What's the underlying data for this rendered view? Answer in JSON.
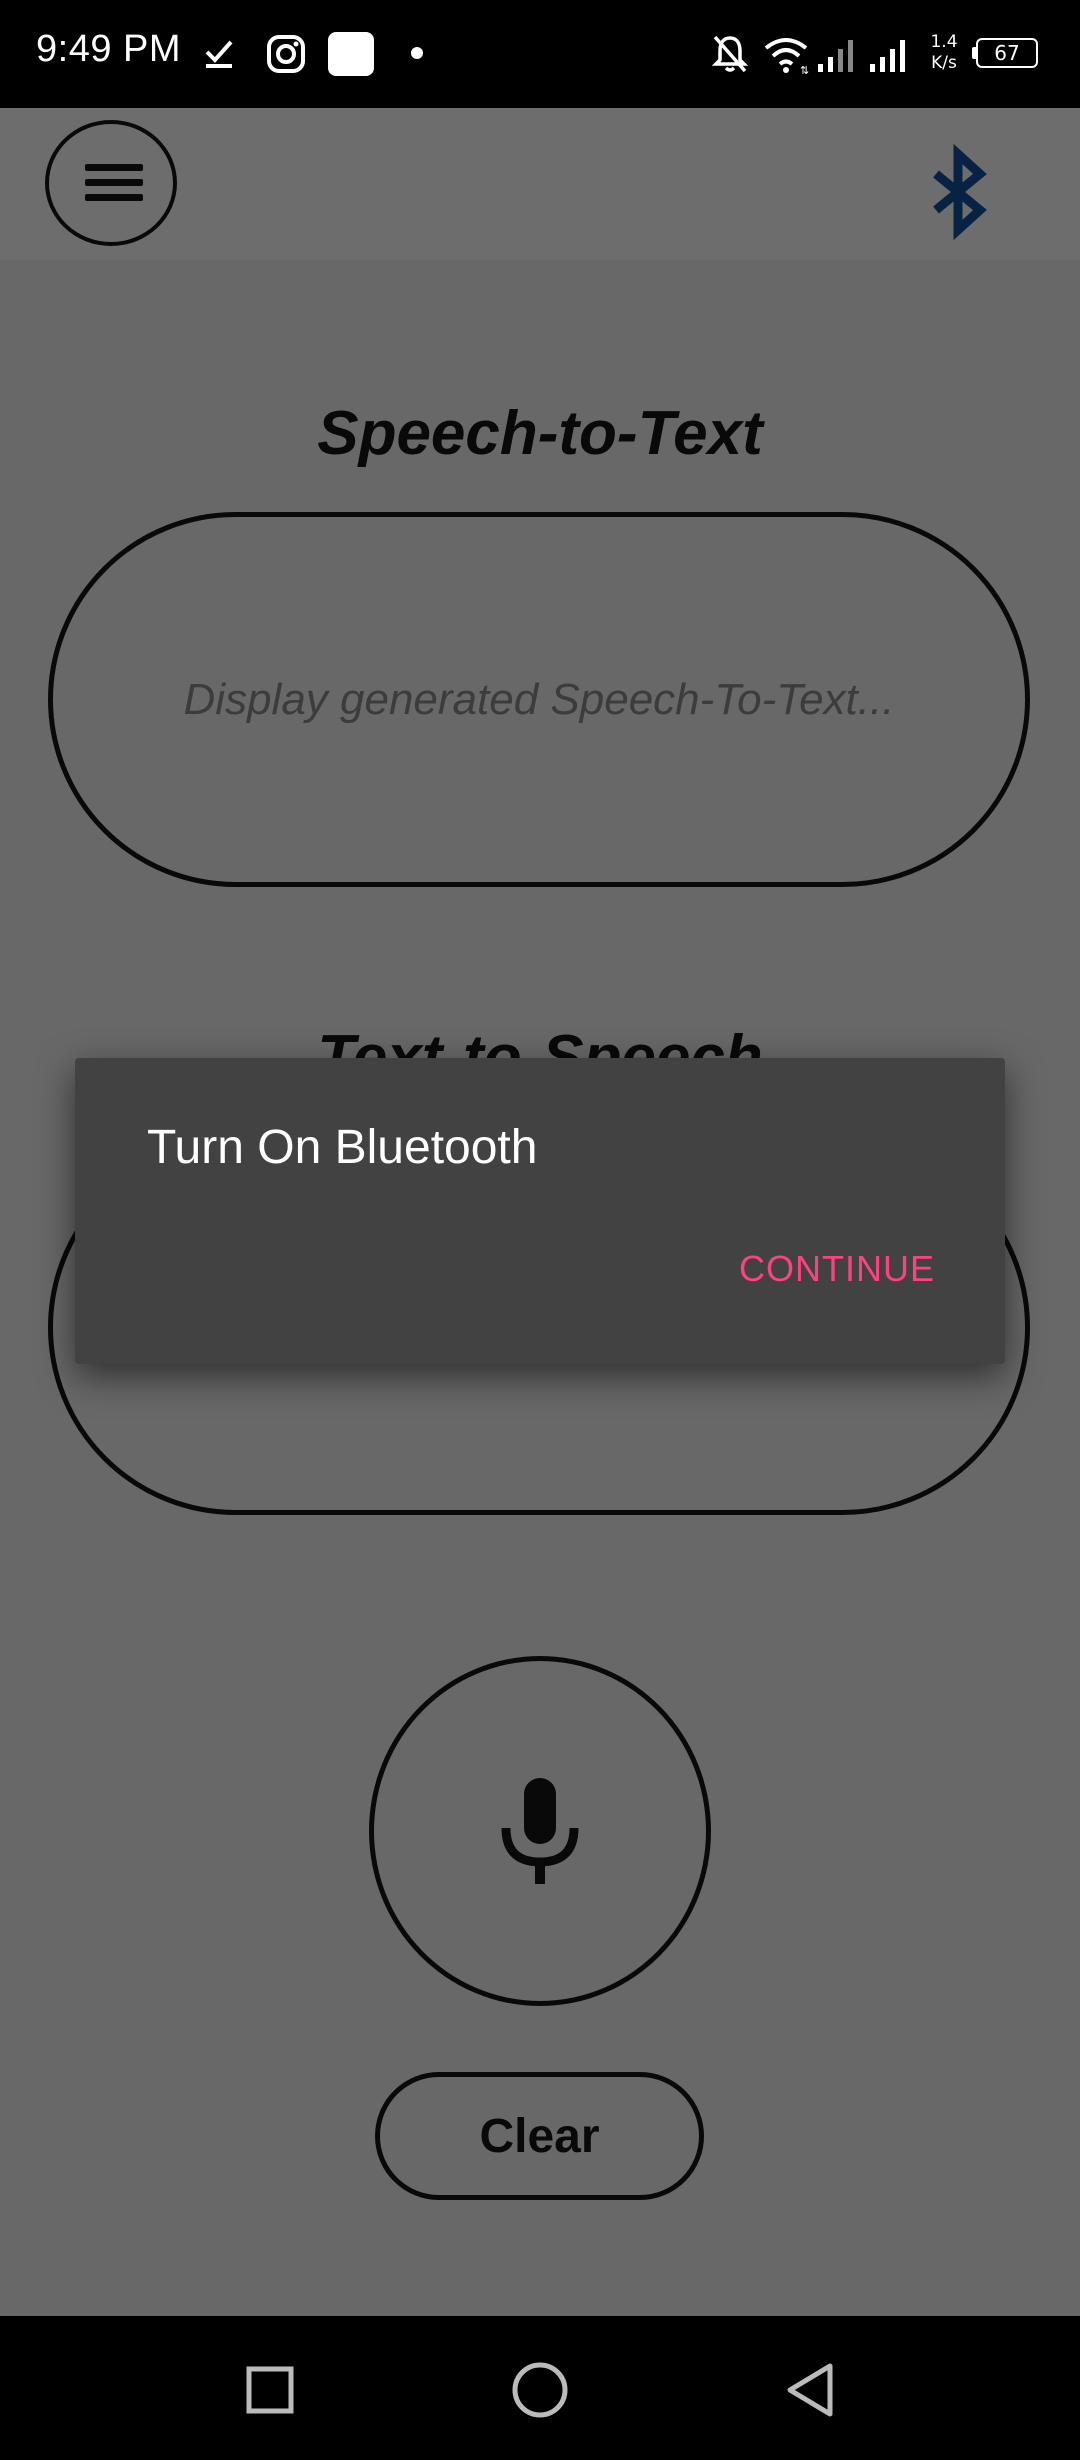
{
  "status_bar": {
    "time": "9:49 PM",
    "net_speed_value": "1.4",
    "net_speed_unit": "K/s",
    "battery": "67",
    "icons": [
      "download-done-icon",
      "instagram-icon",
      "app-square-icon",
      "dot-icon",
      "notifications-off-icon",
      "wifi-icon",
      "signal-icon",
      "signal-icon-2",
      "battery-icon"
    ]
  },
  "app_bar": {
    "menu_icon": "hamburger-menu-icon",
    "bluetooth_icon": "bluetooth-icon",
    "bluetooth_color": "#0d3f7a"
  },
  "speech_to_text": {
    "title": "Speech-to-Text",
    "placeholder": "Display generated Speech-To-Text..."
  },
  "text_to_speech": {
    "title": "Text-to-Speech"
  },
  "controls": {
    "mic_icon": "microphone-icon",
    "clear_label": "Clear"
  },
  "dialog": {
    "title": "Turn On Bluetooth",
    "continue_label": "CONTINUE",
    "accent_color": "#ff4081"
  },
  "nav_bar": {
    "icons": [
      "recents-square-icon",
      "home-circle-icon",
      "back-triangle-icon"
    ]
  }
}
